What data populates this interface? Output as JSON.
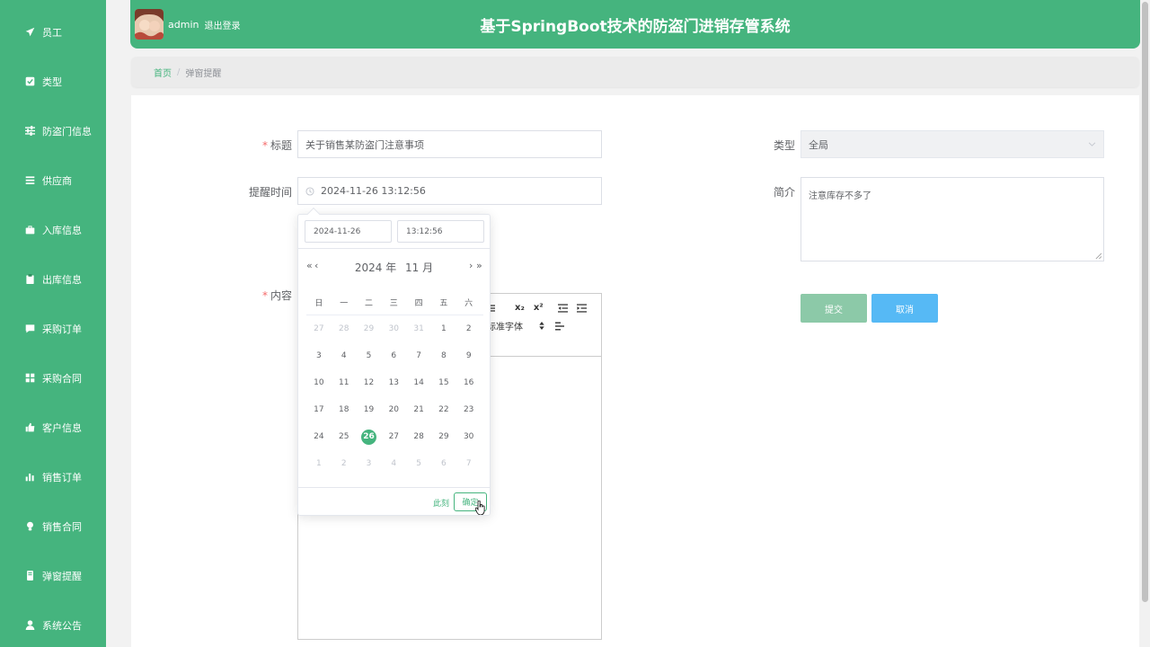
{
  "app": {
    "title": "基于SpringBoot技术的防盗门进销存管系统",
    "user": "admin",
    "logout": "退出登录"
  },
  "sidebar": {
    "items": [
      {
        "label": "员工",
        "icon": "send-icon"
      },
      {
        "label": "类型",
        "icon": "square-icon"
      },
      {
        "label": "防盗门信息",
        "icon": "sliders-icon"
      },
      {
        "label": "供应商",
        "icon": "list-icon"
      },
      {
        "label": "入库信息",
        "icon": "briefcase-icon"
      },
      {
        "label": "出库信息",
        "icon": "clipboard-icon"
      },
      {
        "label": "采购订单",
        "icon": "comment-icon"
      },
      {
        "label": "采购合同",
        "icon": "grid-icon"
      },
      {
        "label": "客户信息",
        "icon": "thumbs-up-icon"
      },
      {
        "label": "销售订单",
        "icon": "bar-chart-icon"
      },
      {
        "label": "销售合同",
        "icon": "bulb-icon"
      },
      {
        "label": "弹窗提醒",
        "icon": "mobile-icon"
      },
      {
        "label": "系统公告",
        "icon": "user-icon"
      }
    ]
  },
  "breadcrumb": {
    "home": "首页",
    "separator": "/",
    "current": "弹窗提醒"
  },
  "form": {
    "required_mark": "*",
    "title_label": "标题",
    "title_value": "关于销售某防盗门注意事项",
    "time_label": "提醒时间",
    "time_value": "2024-11-26 13:12:56",
    "type_label": "类型",
    "type_value": "全局",
    "intro_label": "简介",
    "intro_value": "注意库存不多了",
    "content_label": "内容",
    "submit": "提交",
    "cancel": "取消"
  },
  "editor": {
    "font_family": "标准字体",
    "sub": "x₂",
    "sup": "x²"
  },
  "picker": {
    "date_value": "2024-11-26",
    "time_value": "13:12:56",
    "year_label": "2024 年",
    "month_label": "11 月",
    "prev_year": "«",
    "prev_month": "‹",
    "next_month": "›",
    "next_year": "»",
    "weekdays": [
      "日",
      "一",
      "二",
      "三",
      "四",
      "五",
      "六"
    ],
    "weeks": [
      [
        "27",
        "28",
        "29",
        "30",
        "31",
        "1",
        "2"
      ],
      [
        "3",
        "4",
        "5",
        "6",
        "7",
        "8",
        "9"
      ],
      [
        "10",
        "11",
        "12",
        "13",
        "14",
        "15",
        "16"
      ],
      [
        "17",
        "18",
        "19",
        "20",
        "21",
        "22",
        "23"
      ],
      [
        "24",
        "25",
        "26",
        "27",
        "28",
        "29",
        "30"
      ],
      [
        "1",
        "2",
        "3",
        "4",
        "5",
        "6",
        "7"
      ]
    ],
    "now": "此刻",
    "confirm": "确定"
  },
  "colors": {
    "primary": "#45b47e",
    "submit_bg": "#8cc9a8",
    "cancel_bg": "#56b9f5",
    "required": "#f56c6c"
  }
}
